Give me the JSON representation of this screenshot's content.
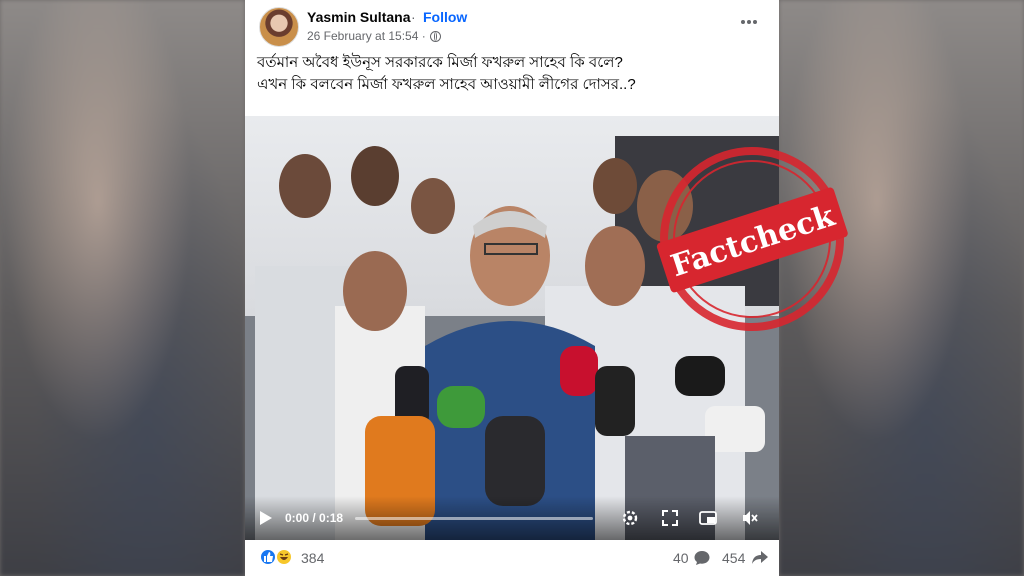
{
  "post": {
    "author": "Yasmin Sultana",
    "separator": "·",
    "follow_label": "Follow",
    "timestamp": "26 February at 15:54 ·",
    "caption_lines": [
      "বর্তমান অবৈধ ইউনূস সরকারকে মির্জা ফখরুল সাহেব কি বলে?",
      "এখন কি বলবেন মির্জা ফখরুল সাহেব আওয়ামী লীগের দোসর..?"
    ]
  },
  "video": {
    "time": "0:00 / 0:18",
    "progress": 0.0
  },
  "stamp": {
    "text": "Factcheck",
    "color": "#d7262f"
  },
  "footer": {
    "reaction_count": "384",
    "comment_count": "40",
    "share_count": "454"
  },
  "colors": {
    "accent": "#0866ff",
    "like": "#1877f2",
    "haha": "#f7c72b"
  }
}
